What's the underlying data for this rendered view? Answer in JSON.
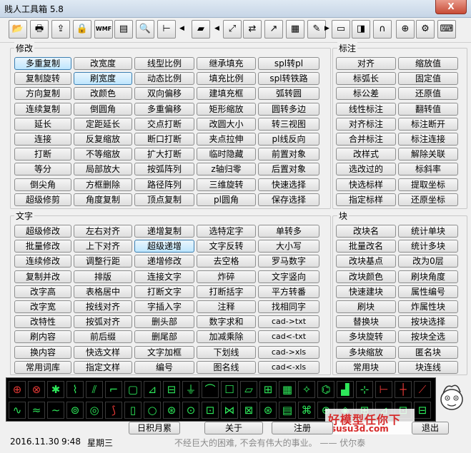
{
  "window": {
    "title": "贱人工具箱 5.8",
    "close_label": "X"
  },
  "toolbar": [
    {
      "name": "open-folder-icon",
      "glyph": "📂"
    },
    {
      "name": "print-icon",
      "glyph": "🖶"
    },
    {
      "name": "export-icon",
      "glyph": "⇪"
    },
    {
      "name": "lock-icon",
      "glyph": "🔒"
    },
    {
      "name": "wmf-icon",
      "glyph": "WMF"
    },
    {
      "name": "sheet-icon",
      "glyph": "▤"
    },
    {
      "name": "search-icon",
      "glyph": "🔍"
    },
    {
      "name": "dimension-icon",
      "glyph": "⊢"
    },
    {
      "name": "layer-icon",
      "glyph": "▰"
    },
    {
      "name": "move-icon",
      "glyph": "⤢"
    },
    {
      "name": "convert-icon",
      "glyph": "⇄"
    },
    {
      "name": "link-icon",
      "glyph": "↗"
    },
    {
      "name": "palette-icon",
      "glyph": "▦"
    },
    {
      "name": "edit-icon",
      "glyph": "✎"
    },
    {
      "name": "monitor-icon",
      "glyph": "▭"
    },
    {
      "name": "eraser-icon",
      "glyph": "◨"
    },
    {
      "name": "magnet-icon",
      "glyph": "∩"
    },
    {
      "name": "crosshair-icon",
      "glyph": "⊕"
    },
    {
      "name": "gear-icon",
      "glyph": "⚙"
    },
    {
      "name": "keyboard-icon",
      "glyph": "⌨"
    }
  ],
  "sections": {
    "modify": "修改",
    "dim": "标注",
    "text": "文字",
    "block": "块"
  },
  "modify_buttons": [
    [
      "多重复制",
      "改宽度",
      "线型比例",
      "继承填充",
      "spl转pl"
    ],
    [
      "复制旋转",
      "刷宽度",
      "动态比例",
      "填充比例",
      "spl转铁路"
    ],
    [
      "方向复制",
      "改颜色",
      "双向偏移",
      "建填充框",
      "弧转圆"
    ],
    [
      "连续复制",
      "倒圆角",
      "多重偏移",
      "矩形缩放",
      "圆转多边"
    ],
    [
      "延长",
      "定距延长",
      "交点打断",
      "改圆大小",
      "转三视图"
    ],
    [
      "连接",
      "反复缩放",
      "断口打断",
      "夹点拉伸",
      "pl线反向"
    ],
    [
      "打断",
      "不等缩放",
      "扩大打断",
      "临时隐藏",
      "前置对象"
    ],
    [
      "等分",
      "局部放大",
      "按弧阵列",
      "z轴归零",
      "后置对象"
    ],
    [
      "倒尖角",
      "方框删除",
      "路径阵列",
      "三维旋转",
      "快速选择"
    ],
    [
      "超级修剪",
      "角度复制",
      "顶点复制",
      "pl圆角",
      "保存选择"
    ]
  ],
  "dim_buttons": [
    [
      "对齐",
      "缩放值"
    ],
    [
      "标弧长",
      "固定值"
    ],
    [
      "标公差",
      "还原值"
    ],
    [
      "线性标注",
      "翻转值"
    ],
    [
      "对齐标注",
      "标注断开"
    ],
    [
      "合并标注",
      "标注连接"
    ],
    [
      "改样式",
      "解除关联"
    ],
    [
      "选改过的",
      "标斜率"
    ],
    [
      "快选标样",
      "提取坐标"
    ],
    [
      "指定标样",
      "还原坐标"
    ]
  ],
  "text_buttons": [
    [
      "超级修改",
      "左右对齐",
      "递增复制",
      "选特定字",
      "单转多"
    ],
    [
      "批量修改",
      "上下对齐",
      "超级递增",
      "文字反转",
      "大小写"
    ],
    [
      "连续修改",
      "调整行距",
      "递增修改",
      "去空格",
      "罗马数字"
    ],
    [
      "复制并改",
      "排版",
      "连接文字",
      "炸碎",
      "文字竖向"
    ],
    [
      "改字高",
      "表格居中",
      "打断文字",
      "打断括字",
      "平方转番"
    ],
    [
      "改字宽",
      "按线对齐",
      "字插入字",
      "注释",
      "找相同字"
    ],
    [
      "改特性",
      "按弧对齐",
      "删头部",
      "数字求和",
      "cad->txt"
    ],
    [
      "刷内容",
      "前后缀",
      "删尾部",
      "加减乘除",
      "cad<-txt"
    ],
    [
      "换内容",
      "快选文样",
      "文字加框",
      "下划线",
      "cad->xls"
    ],
    [
      "常用词库",
      "指定文样",
      "编号",
      "图名线",
      "cad<-xls"
    ]
  ],
  "block_buttons": [
    [
      "改块名",
      "统计单块"
    ],
    [
      "批量改名",
      "统计多块"
    ],
    [
      "改块基点",
      "改为0层"
    ],
    [
      "改块颜色",
      "刷块角度"
    ],
    [
      "快速建块",
      "属性编号"
    ],
    [
      "刷块",
      "炸属性块"
    ],
    [
      "替换块",
      "按块选择"
    ],
    [
      "多块旋转",
      "按块全选"
    ],
    [
      "多块缩放",
      "匿名块"
    ],
    [
      "常用块",
      "块连线"
    ]
  ],
  "bottom_buttons": {
    "calendar": "日积月累",
    "about": "关于",
    "register": "注册",
    "exit": "退出"
  },
  "status": {
    "date": "2016.11.30",
    "time": "9:48",
    "weekday": "星期三",
    "motto": "不经巨大的困难, 不会有伟大的事业。 —— 伏尔泰"
  },
  "watermark": {
    "line1": "好模型任你下",
    "line2": "susu3d.com"
  },
  "colors": {
    "strip_red": "#e53935",
    "strip_green": "#2ee85a",
    "highlight": "#bee6fd"
  }
}
